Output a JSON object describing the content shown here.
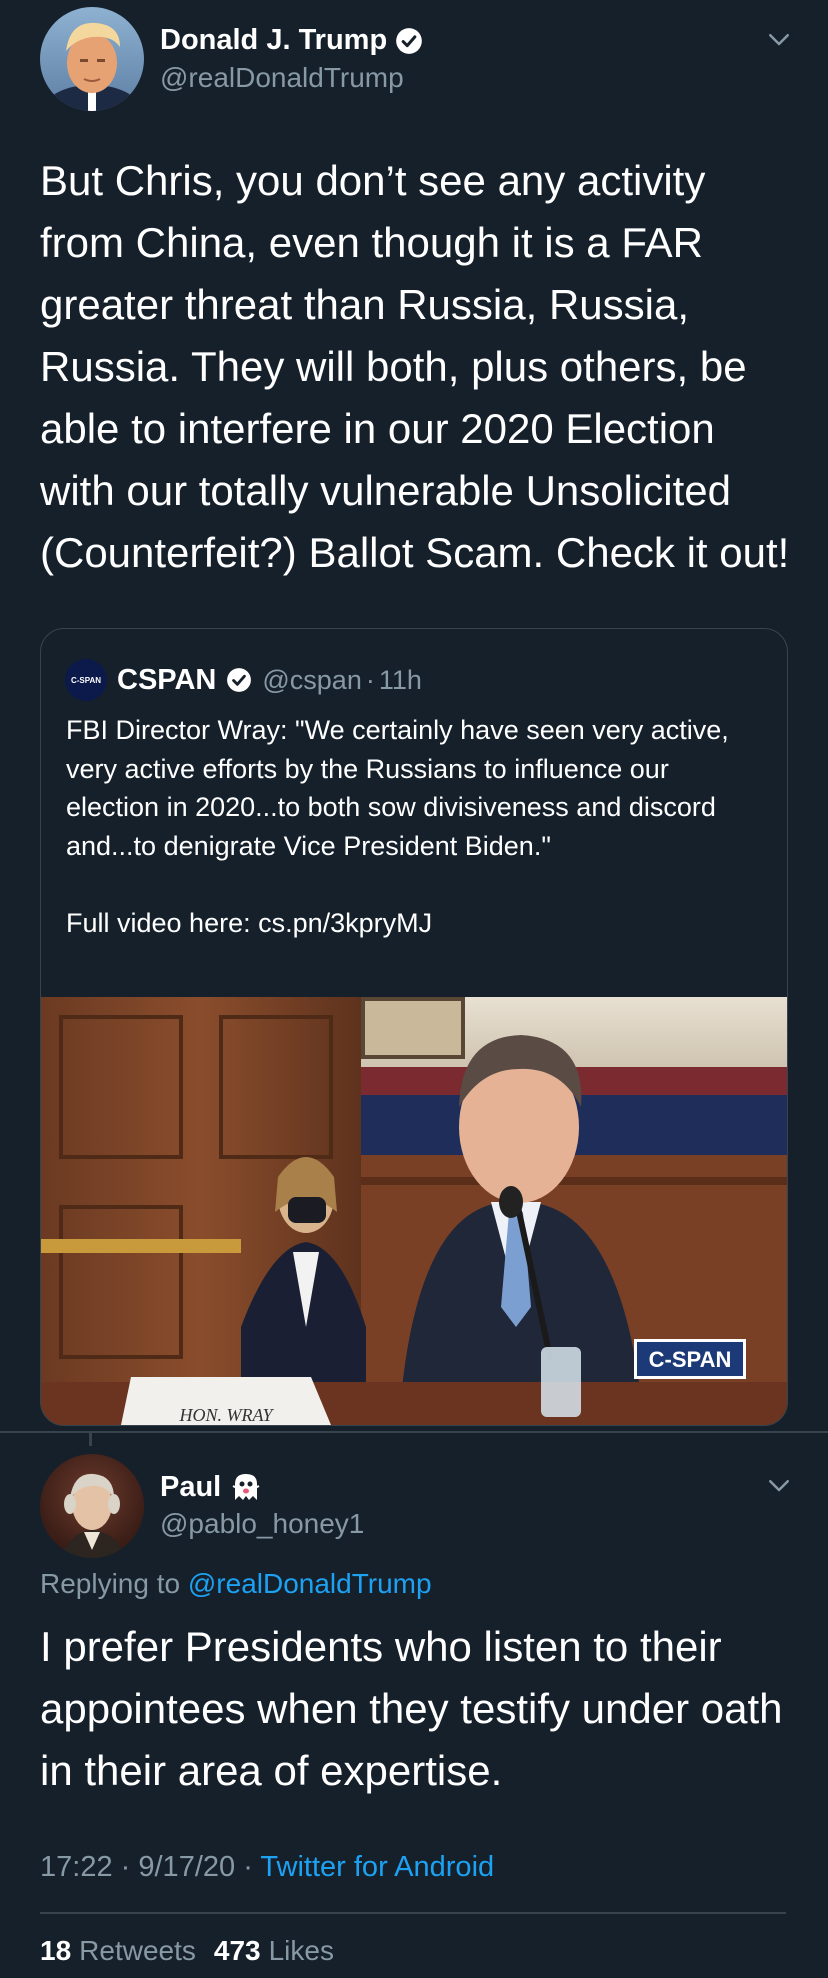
{
  "main_tweet": {
    "author_name": "Donald J. Trump",
    "author_handle": "@realDonaldTrump",
    "text": "But Chris, you don’t see any activity from China, even though it is a FAR greater threat than Russia, Russia, Russia. They will both, plus others, be able to interfere in our 2020 Election with our totally vulnerable Unsolicited (Counterfeit?) Ballot Scam. Check it out!"
  },
  "quoted_tweet": {
    "avatar_label": "C-SPAN",
    "author_name": "CSPAN",
    "author_handle": "@cspan",
    "separator": "·",
    "time": "11h",
    "text": "FBI Director Wray: \"We certainly have seen very active, very active efforts by the Russians to influence our election in 2020...to both sow divisiveness and discord and...to denigrate Vice President Biden.\"\n\nFull video here: cs.pn/3kpryMJ",
    "media": {
      "watermark": "C-SPAN",
      "nameplate": "HON. WRAY"
    }
  },
  "reply_tweet": {
    "author_name": "Paul",
    "author_handle": "@pablo_honey1",
    "replying_prefix": "Replying to",
    "replying_to": "@realDonaldTrump",
    "text": "I prefer Presidents who listen to their appointees when they testify under oath in their area of expertise.",
    "time": "17:22",
    "date": "9/17/20",
    "dot": "·",
    "source": "Twitter for Android",
    "retweets_count": "18",
    "retweets_label": "Retweets",
    "likes_count": "473",
    "likes_label": "Likes"
  },
  "colors": {
    "background": "#15202b",
    "secondary_text": "#8899a6",
    "link": "#1da1f2",
    "border": "#38444d"
  }
}
